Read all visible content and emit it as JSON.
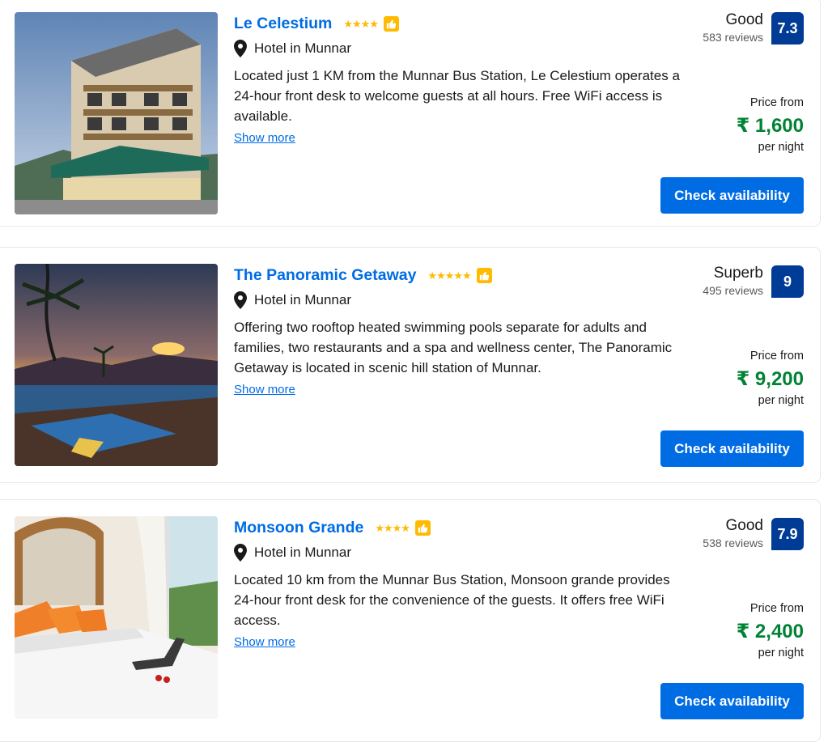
{
  "hotels": [
    {
      "name": "Le Celestium",
      "stars": "★★★★",
      "location": "Hotel in Munnar",
      "description": "Located just 1 KM from the Munnar Bus Station, Le Celestium operates a 24-hour front desk to welcome guests at all hours. Free WiFi access is available.",
      "show_more": "Show more",
      "rating_word": "Good",
      "reviews": "583 reviews",
      "score": "7.3",
      "price_from": "Price from",
      "price": "₹ 1,600",
      "per_night": "per night",
      "cta": "Check availability"
    },
    {
      "name": "The Panoramic Getaway",
      "stars": "★★★★★",
      "location": "Hotel in Munnar",
      "description": "Offering two rooftop heated swimming pools separate for adults and families, two restaurants and a spa and wellness center, The Panoramic Getaway is located in scenic hill station of Munnar.",
      "show_more": "Show more",
      "rating_word": "Superb",
      "reviews": "495 reviews",
      "score": "9",
      "price_from": "Price from",
      "price": "₹ 9,200",
      "per_night": "per night",
      "cta": "Check availability"
    },
    {
      "name": "Monsoon Grande",
      "stars": "★★★★",
      "location": "Hotel in Munnar",
      "description": "Located 10 km from the Munnar Bus Station, Monsoon grande provides 24-hour front desk for the convenience of the guests. It offers free WiFi access.",
      "show_more": "Show more",
      "rating_word": "Good",
      "reviews": "538 reviews",
      "score": "7.9",
      "price_from": "Price from",
      "price": "₹ 2,400",
      "per_night": "per night",
      "cta": "Check availability"
    }
  ],
  "colors": {
    "link_blue": "#006ce4",
    "score_bg": "#003b95",
    "price_green": "#008234",
    "star_yellow": "#febb02"
  }
}
